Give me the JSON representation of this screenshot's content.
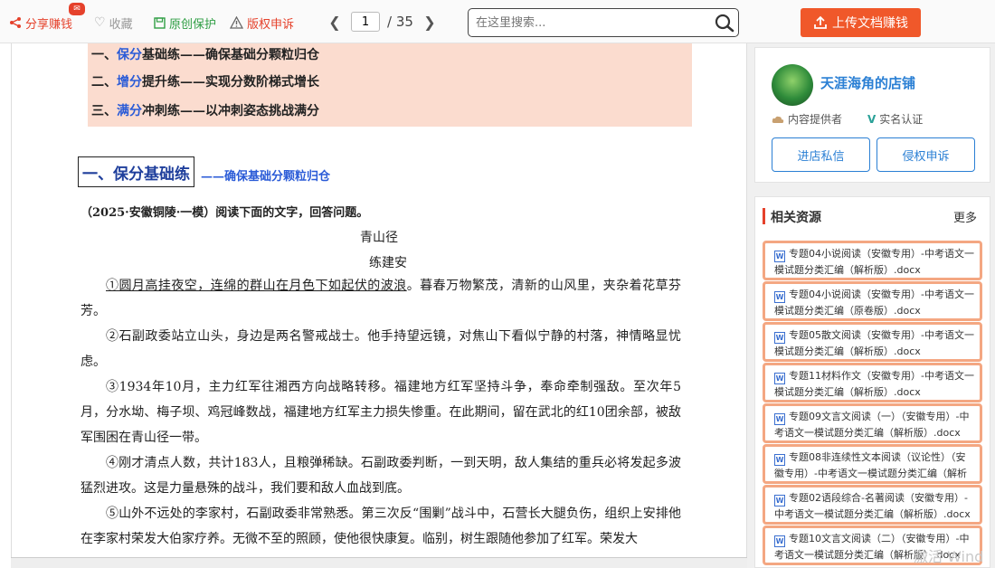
{
  "toolbar": {
    "share_label": "分享赚钱",
    "collect_label": "收藏",
    "protect_label": "原创保护",
    "report_label": "版权申诉",
    "page_current": "1",
    "page_total": "/ 35",
    "search_placeholder": "在这里搜索...",
    "upload_label": "上传文档赚钱"
  },
  "document": {
    "contents": {
      "line1": {
        "prefix": "一、",
        "highlight": "保分",
        "rest": "基础练——确保基础分颗粒归仓"
      },
      "line2": {
        "prefix": "二、",
        "highlight": "增分",
        "rest": "提升练——实现分数阶梯式增长"
      },
      "line3": {
        "prefix": "三、",
        "highlight": "满分",
        "rest": "冲刺练——以冲刺姿态挑战满分"
      }
    },
    "section_title": "一、保分基础练",
    "section_subtitle": "——确保基础分颗粒归仓",
    "source_line": "（2025·安徽铜陵·一模）阅读下面的文字，回答问题。",
    "story_title": "青山径",
    "author": "练建安",
    "p1_underlined": "①圆月高挂夜空，连绵的群山在月色下如起伏的波浪",
    "p1_rest": "。暮春万物繁茂，清新的山风里，夹杂着花草芬芳。",
    "p2": "②石副政委站立山头，身边是两名警戒战士。他手持望远镜，对焦山下看似宁静的村落，神情略显忧虑。",
    "p3": "③1934年10月，主力红军往湘西方向战略转移。福建地方红军坚持斗争，奉命牵制强敌。至次年5月，分水坳、梅子坝、鸡冠峰数战，福建地方红军主力损失惨重。在此期间，留在武北的红10团余部，被敌军围困在青山径一带。",
    "p4": "④刚才清点人数，共计183人，且粮弹稀缺。石副政委判断，一到天明，敌人集结的重兵必将发起多波猛烈进攻。这是力量悬殊的战斗，我们要和敌人血战到底。",
    "p5": "⑤山外不远处的李家村，石副政委非常熟悉。第三次反“围剿”战斗中，石营长大腿负伤，组织上安排他在李家村荣发大伯家疗养。无微不至的照顾，使他很快康复。临别，树生跟随他参加了红军。荣发大"
  },
  "store": {
    "name": "天涯海角的店铺",
    "provider_label": "内容提供者",
    "verified_label": "实名认证",
    "message_button": "进店私信",
    "report_button": "侵权申诉"
  },
  "related": {
    "title": "相关资源",
    "more": "更多",
    "items": [
      "专题04小说阅读（安徽专用）-中考语文一模试题分类汇编（解析版）.docx",
      "专题04小说阅读（安徽专用）-中考语文一模试题分类汇编（原卷版）.docx",
      "专题05散文阅读（安徽专用）-中考语文一模试题分类汇编（解析版）.docx",
      "专题11材料作文（安徽专用）-中考语文一模试题分类汇编（解析版）.docx",
      "专题09文言文阅读（一）（安徽专用）-中考语文一模试题分类汇编（解析版）.docx",
      "专题08非连续性文本阅读（议论性）（安徽专用）-中考语文一模试题分类汇编（解析",
      "专题02语段综合-名著阅读（安徽专用）-中考语文一模试题分类汇编（解析版）.docx",
      "专题10文言文阅读（二）（安徽专用）-中考语文一模试题分类汇编（解析版）.docx"
    ]
  },
  "watermark": "激活 Wind"
}
